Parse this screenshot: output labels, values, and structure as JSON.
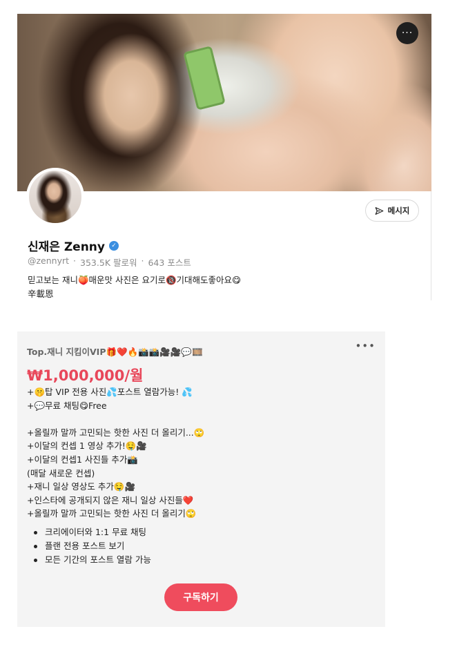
{
  "profile": {
    "display_name": "신재은 Zenny",
    "handle": "@zennyrt",
    "followers": "353.5K 팔로워",
    "posts": "643 포스트",
    "separator": "·",
    "bio_line1": "믿고보는 재니🍑매운맛 사진은 요기로🔞기대해도좋아요😋",
    "bio_line2": "辛載恩",
    "message_button_label": "메시지",
    "more_button_label": "···",
    "verified_mark": "✓",
    "icons": [
      "more-horizontal-icon",
      "send-icon",
      "verified-icon"
    ],
    "colors": {
      "verified": "#3b8fe0"
    }
  },
  "plan": {
    "title": "Top.재니 지킴이VIP🎁❤️🔥📸📸🎥🎥💬🎞️",
    "more_label": "•••",
    "price": "₩1,000,000/월",
    "description": [
      "+🤫탑 VIP 전용 사진💦포스트 열람가능! 💦",
      "+💬무료 채팅😋Free",
      "",
      "+올릴까 말까 고민되는 핫한 사진 더 올리기...🙄",
      "+이달의 컨셉 1 영상 추가!🤤🎥",
      "+이달의 컨셉1 사진들 추가📸",
      "(매달 새로운 컨셉)",
      "+재니 일상 영상도 추가🤤🎥",
      "+인스타에 공개되지 않은 재니 일상 사진들❤️",
      "+올릴까 말까 고민되는 핫한 사진 더 올리기🙄"
    ],
    "benefits": [
      "크리에이터와 1:1 무료 채팅",
      "플랜 전용 포스트 보기",
      "모든 기간의 포스트 열람 가능"
    ],
    "subscribe_label": "구독하기",
    "colors": {
      "price": "#e8475a",
      "subscribe_button": "#ef4c5d",
      "card_background": "#f4f4f4"
    }
  }
}
